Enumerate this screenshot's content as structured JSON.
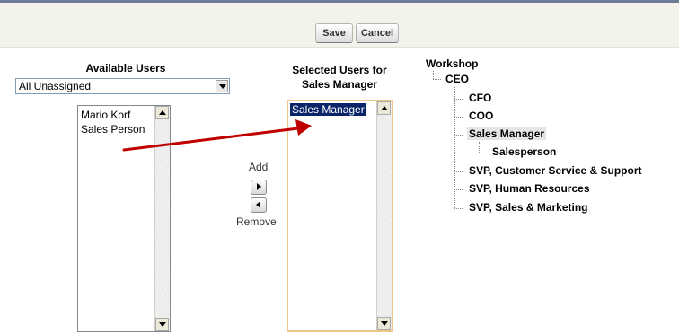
{
  "toolbar": {
    "save_label": "Save",
    "cancel_label": "Cancel"
  },
  "available": {
    "title": "Available Users",
    "filter_value": "All Unassigned",
    "items": [
      "Mario Korf",
      "Sales Person"
    ]
  },
  "mover": {
    "add_label": "Add",
    "remove_label": "Remove"
  },
  "selected": {
    "title_line1": "Selected Users for",
    "title_line2": "Sales Manager",
    "items": [
      "Sales Manager"
    ]
  },
  "tree": {
    "root": "Workshop",
    "nodes": [
      "CEO",
      "CFO",
      "COO",
      "Sales Manager",
      "Salesperson",
      "SVP, Customer Service & Support",
      "SVP, Human Resources",
      "SVP, Sales & Marketing"
    ]
  },
  "annotation_color": "#c00000"
}
